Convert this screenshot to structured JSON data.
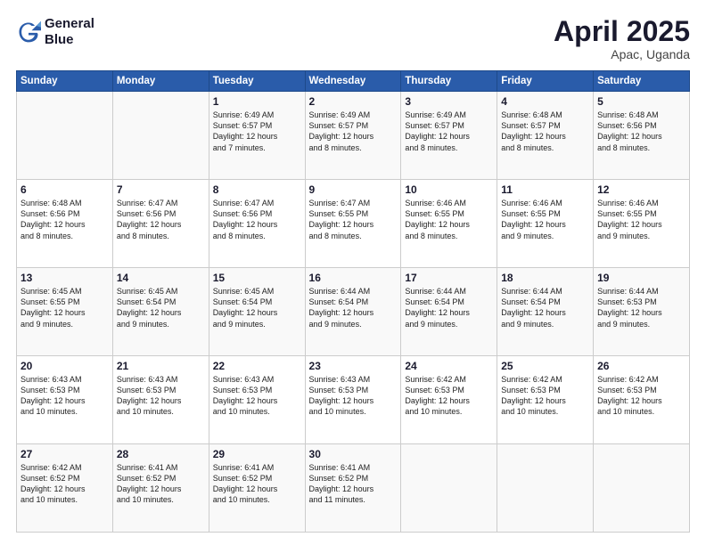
{
  "header": {
    "logo_line1": "General",
    "logo_line2": "Blue",
    "title": "April 2025",
    "subtitle": "Apac, Uganda"
  },
  "days_of_week": [
    "Sunday",
    "Monday",
    "Tuesday",
    "Wednesday",
    "Thursday",
    "Friday",
    "Saturday"
  ],
  "weeks": [
    [
      {
        "day": "",
        "content": ""
      },
      {
        "day": "",
        "content": ""
      },
      {
        "day": "1",
        "content": "Sunrise: 6:49 AM\nSunset: 6:57 PM\nDaylight: 12 hours\nand 7 minutes."
      },
      {
        "day": "2",
        "content": "Sunrise: 6:49 AM\nSunset: 6:57 PM\nDaylight: 12 hours\nand 8 minutes."
      },
      {
        "day": "3",
        "content": "Sunrise: 6:49 AM\nSunset: 6:57 PM\nDaylight: 12 hours\nand 8 minutes."
      },
      {
        "day": "4",
        "content": "Sunrise: 6:48 AM\nSunset: 6:57 PM\nDaylight: 12 hours\nand 8 minutes."
      },
      {
        "day": "5",
        "content": "Sunrise: 6:48 AM\nSunset: 6:56 PM\nDaylight: 12 hours\nand 8 minutes."
      }
    ],
    [
      {
        "day": "6",
        "content": "Sunrise: 6:48 AM\nSunset: 6:56 PM\nDaylight: 12 hours\nand 8 minutes."
      },
      {
        "day": "7",
        "content": "Sunrise: 6:47 AM\nSunset: 6:56 PM\nDaylight: 12 hours\nand 8 minutes."
      },
      {
        "day": "8",
        "content": "Sunrise: 6:47 AM\nSunset: 6:56 PM\nDaylight: 12 hours\nand 8 minutes."
      },
      {
        "day": "9",
        "content": "Sunrise: 6:47 AM\nSunset: 6:55 PM\nDaylight: 12 hours\nand 8 minutes."
      },
      {
        "day": "10",
        "content": "Sunrise: 6:46 AM\nSunset: 6:55 PM\nDaylight: 12 hours\nand 8 minutes."
      },
      {
        "day": "11",
        "content": "Sunrise: 6:46 AM\nSunset: 6:55 PM\nDaylight: 12 hours\nand 9 minutes."
      },
      {
        "day": "12",
        "content": "Sunrise: 6:46 AM\nSunset: 6:55 PM\nDaylight: 12 hours\nand 9 minutes."
      }
    ],
    [
      {
        "day": "13",
        "content": "Sunrise: 6:45 AM\nSunset: 6:55 PM\nDaylight: 12 hours\nand 9 minutes."
      },
      {
        "day": "14",
        "content": "Sunrise: 6:45 AM\nSunset: 6:54 PM\nDaylight: 12 hours\nand 9 minutes."
      },
      {
        "day": "15",
        "content": "Sunrise: 6:45 AM\nSunset: 6:54 PM\nDaylight: 12 hours\nand 9 minutes."
      },
      {
        "day": "16",
        "content": "Sunrise: 6:44 AM\nSunset: 6:54 PM\nDaylight: 12 hours\nand 9 minutes."
      },
      {
        "day": "17",
        "content": "Sunrise: 6:44 AM\nSunset: 6:54 PM\nDaylight: 12 hours\nand 9 minutes."
      },
      {
        "day": "18",
        "content": "Sunrise: 6:44 AM\nSunset: 6:54 PM\nDaylight: 12 hours\nand 9 minutes."
      },
      {
        "day": "19",
        "content": "Sunrise: 6:44 AM\nSunset: 6:53 PM\nDaylight: 12 hours\nand 9 minutes."
      }
    ],
    [
      {
        "day": "20",
        "content": "Sunrise: 6:43 AM\nSunset: 6:53 PM\nDaylight: 12 hours\nand 10 minutes."
      },
      {
        "day": "21",
        "content": "Sunrise: 6:43 AM\nSunset: 6:53 PM\nDaylight: 12 hours\nand 10 minutes."
      },
      {
        "day": "22",
        "content": "Sunrise: 6:43 AM\nSunset: 6:53 PM\nDaylight: 12 hours\nand 10 minutes."
      },
      {
        "day": "23",
        "content": "Sunrise: 6:43 AM\nSunset: 6:53 PM\nDaylight: 12 hours\nand 10 minutes."
      },
      {
        "day": "24",
        "content": "Sunrise: 6:42 AM\nSunset: 6:53 PM\nDaylight: 12 hours\nand 10 minutes."
      },
      {
        "day": "25",
        "content": "Sunrise: 6:42 AM\nSunset: 6:53 PM\nDaylight: 12 hours\nand 10 minutes."
      },
      {
        "day": "26",
        "content": "Sunrise: 6:42 AM\nSunset: 6:53 PM\nDaylight: 12 hours\nand 10 minutes."
      }
    ],
    [
      {
        "day": "27",
        "content": "Sunrise: 6:42 AM\nSunset: 6:52 PM\nDaylight: 12 hours\nand 10 minutes."
      },
      {
        "day": "28",
        "content": "Sunrise: 6:41 AM\nSunset: 6:52 PM\nDaylight: 12 hours\nand 10 minutes."
      },
      {
        "day": "29",
        "content": "Sunrise: 6:41 AM\nSunset: 6:52 PM\nDaylight: 12 hours\nand 10 minutes."
      },
      {
        "day": "30",
        "content": "Sunrise: 6:41 AM\nSunset: 6:52 PM\nDaylight: 12 hours\nand 11 minutes."
      },
      {
        "day": "",
        "content": ""
      },
      {
        "day": "",
        "content": ""
      },
      {
        "day": "",
        "content": ""
      }
    ]
  ]
}
